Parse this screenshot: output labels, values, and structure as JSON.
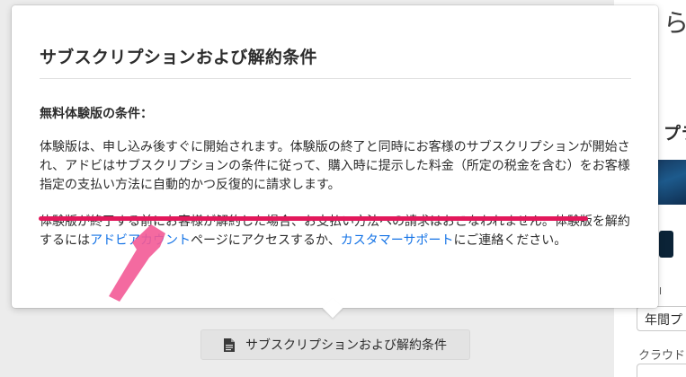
{
  "background": {
    "top_char": "ら",
    "plan_text": "プラ",
    "select_value": "年間プ",
    "cloud_label": "クラウド"
  },
  "popover": {
    "title": "サブスクリプションおよび解約条件",
    "section_title": "無料体験版の条件：",
    "paragraph_1": "体験版は、申し込み後すぐに開始されます。体験版の終了と同時にお客様のサブスクリプションが開始され、アドビはサブスクリプションの条件に従って、購入時に提示した料金（所定の税金を含む）をお客様指定の支払い方法に自動的かつ反復的に請求します。",
    "paragraph_2_part_1": "体験版が終了する前にお客様が解約した場合、お支払い方法への請求はおこなわれません。体験版を解約するには",
    "link_adobe_account": "アドビアカウント",
    "paragraph_2_part_2": "ページにアクセスするか、",
    "link_customer_support": "カスタマーサポート",
    "paragraph_2_part_3": "にご連絡ください。"
  },
  "terms_button": {
    "label": "サブスクリプションおよび解約条件",
    "icon": "document-icon"
  },
  "colors": {
    "link": "#1473e6",
    "highlight": "#e2185b",
    "arrow": "#f35a96"
  }
}
